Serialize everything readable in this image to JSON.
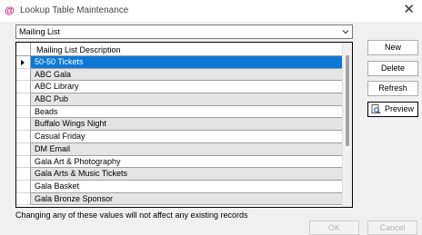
{
  "window": {
    "title": "Lookup Table Maintenance",
    "app_icon": "@",
    "close_glyph": "✕"
  },
  "combo": {
    "selected": "Mailing List"
  },
  "grid": {
    "column_header": "Mailing List Description",
    "selected_index": 0,
    "rows": [
      "50-50 Tickets",
      "ABC Gala",
      "ABC Library",
      "ABC Pub",
      "Beads",
      "Buffalo Wings Night",
      "Casual Friday",
      "DM Email",
      "Gala Art & Photography",
      "Gala Arts & Music Tickets",
      "Gala Basket",
      "Gala Bronze Sponsor"
    ]
  },
  "buttons": {
    "new": "New",
    "delete": "Delete",
    "refresh": "Refresh",
    "preview": "Preview",
    "ok": "OK",
    "cancel": "Cancel"
  },
  "note": "Changing any of these values will not affect any existing records",
  "colors": {
    "selection": "#0d78d6",
    "alt_row": "#e4e4e4",
    "app_icon": "#c1187c"
  }
}
